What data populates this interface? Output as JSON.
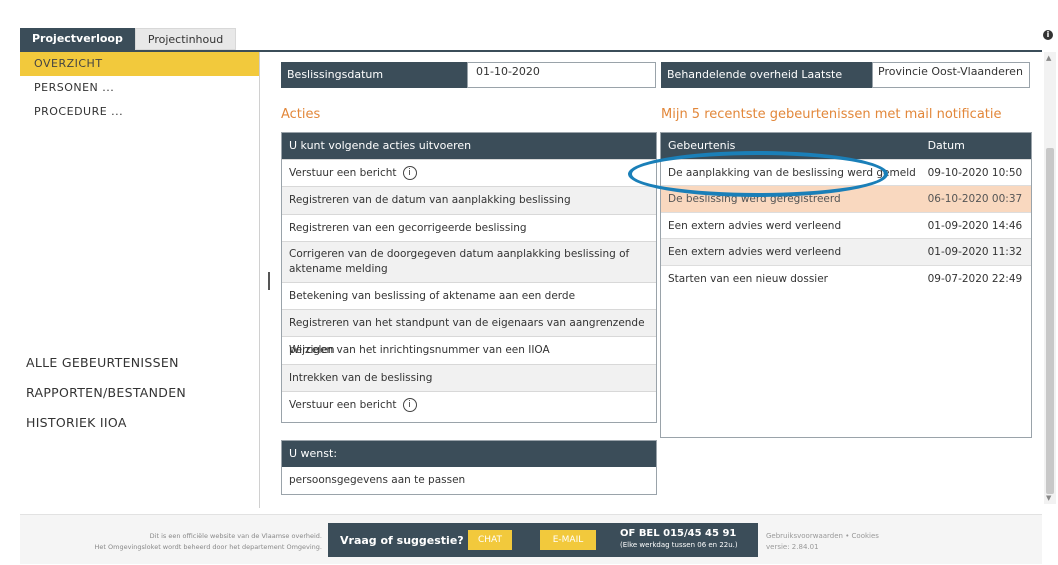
{
  "tabs": {
    "active": "Projectverloop",
    "inactive": "Projectinhoud"
  },
  "info_icon": "i",
  "sidebar": {
    "top_items": [
      "OVERZICHT",
      "PERSONEN ...",
      "PROCEDURE ..."
    ],
    "bottom_items": [
      "ALLE GEBEURTENISSEN",
      "RAPPORTEN/BESTANDEN",
      "HISTORIEK IIOA"
    ]
  },
  "fields": {
    "beslissingsdatum_label": "Beslissingsdatum",
    "beslissingsdatum_value": "01-10-2020",
    "overheid_label": "Behandelende overheid Laatste Aanleg",
    "overheid_value": "Provincie Oost-Vlaanderen"
  },
  "acties": {
    "title": "Acties",
    "panel_header": "U kunt volgende acties uitvoeren",
    "info_glyph": "i",
    "items": [
      "Verstuur een bericht",
      "Registreren van de datum van aanplakking beslissing",
      "Registreren van een gecorrigeerde beslissing",
      "Corrigeren van de doorgegeven datum aanplakking beslissing of aktename melding",
      "Betekening van beslissing of aktename aan een derde",
      "Registreren van het standpunt van de eigenaars van aangrenzende percelen",
      "Wijzigen van het inrichtingsnummer van een IIOA",
      "Intrekken van de beslissing",
      "Verstuur een bericht"
    ]
  },
  "wenst": {
    "header": "U wenst:",
    "item": "persoonsgegevens aan te passen"
  },
  "events": {
    "title": "Mijn 5 recentste gebeurtenissen met mail notificatie",
    "col_event": "Gebeurtenis",
    "col_date": "Datum",
    "rows": [
      {
        "event": "De aanplakking van de beslissing werd gemeld",
        "date": "09-10-2020 10:50"
      },
      {
        "event": "De beslissing werd geregistreerd",
        "date": "06-10-2020 00:37"
      },
      {
        "event": "Een extern advies werd verleend",
        "date": "01-09-2020 14:46"
      },
      {
        "event": "Een extern advies werd verleend",
        "date": "01-09-2020 11:32"
      },
      {
        "event": "Starten van een nieuw dossier",
        "date": "09-07-2020 22:49"
      }
    ]
  },
  "footer": {
    "left_line1": "Dit is een officiële website van de Vlaamse overheid.",
    "left_line2": "Het Omgevingsloket wordt beheerd door het departement Omgeving.",
    "vraag": "Vraag of suggestie?",
    "chat": "CHAT",
    "email": "E-MAIL",
    "bel": "OF BEL 015/45 45 91",
    "bel_sub": "(Elke werkdag tussen 06 en 22u.)",
    "right_line1": "Gebruiksvoorwaarden • Cookies",
    "right_line2": "versie: 2.84.01"
  }
}
